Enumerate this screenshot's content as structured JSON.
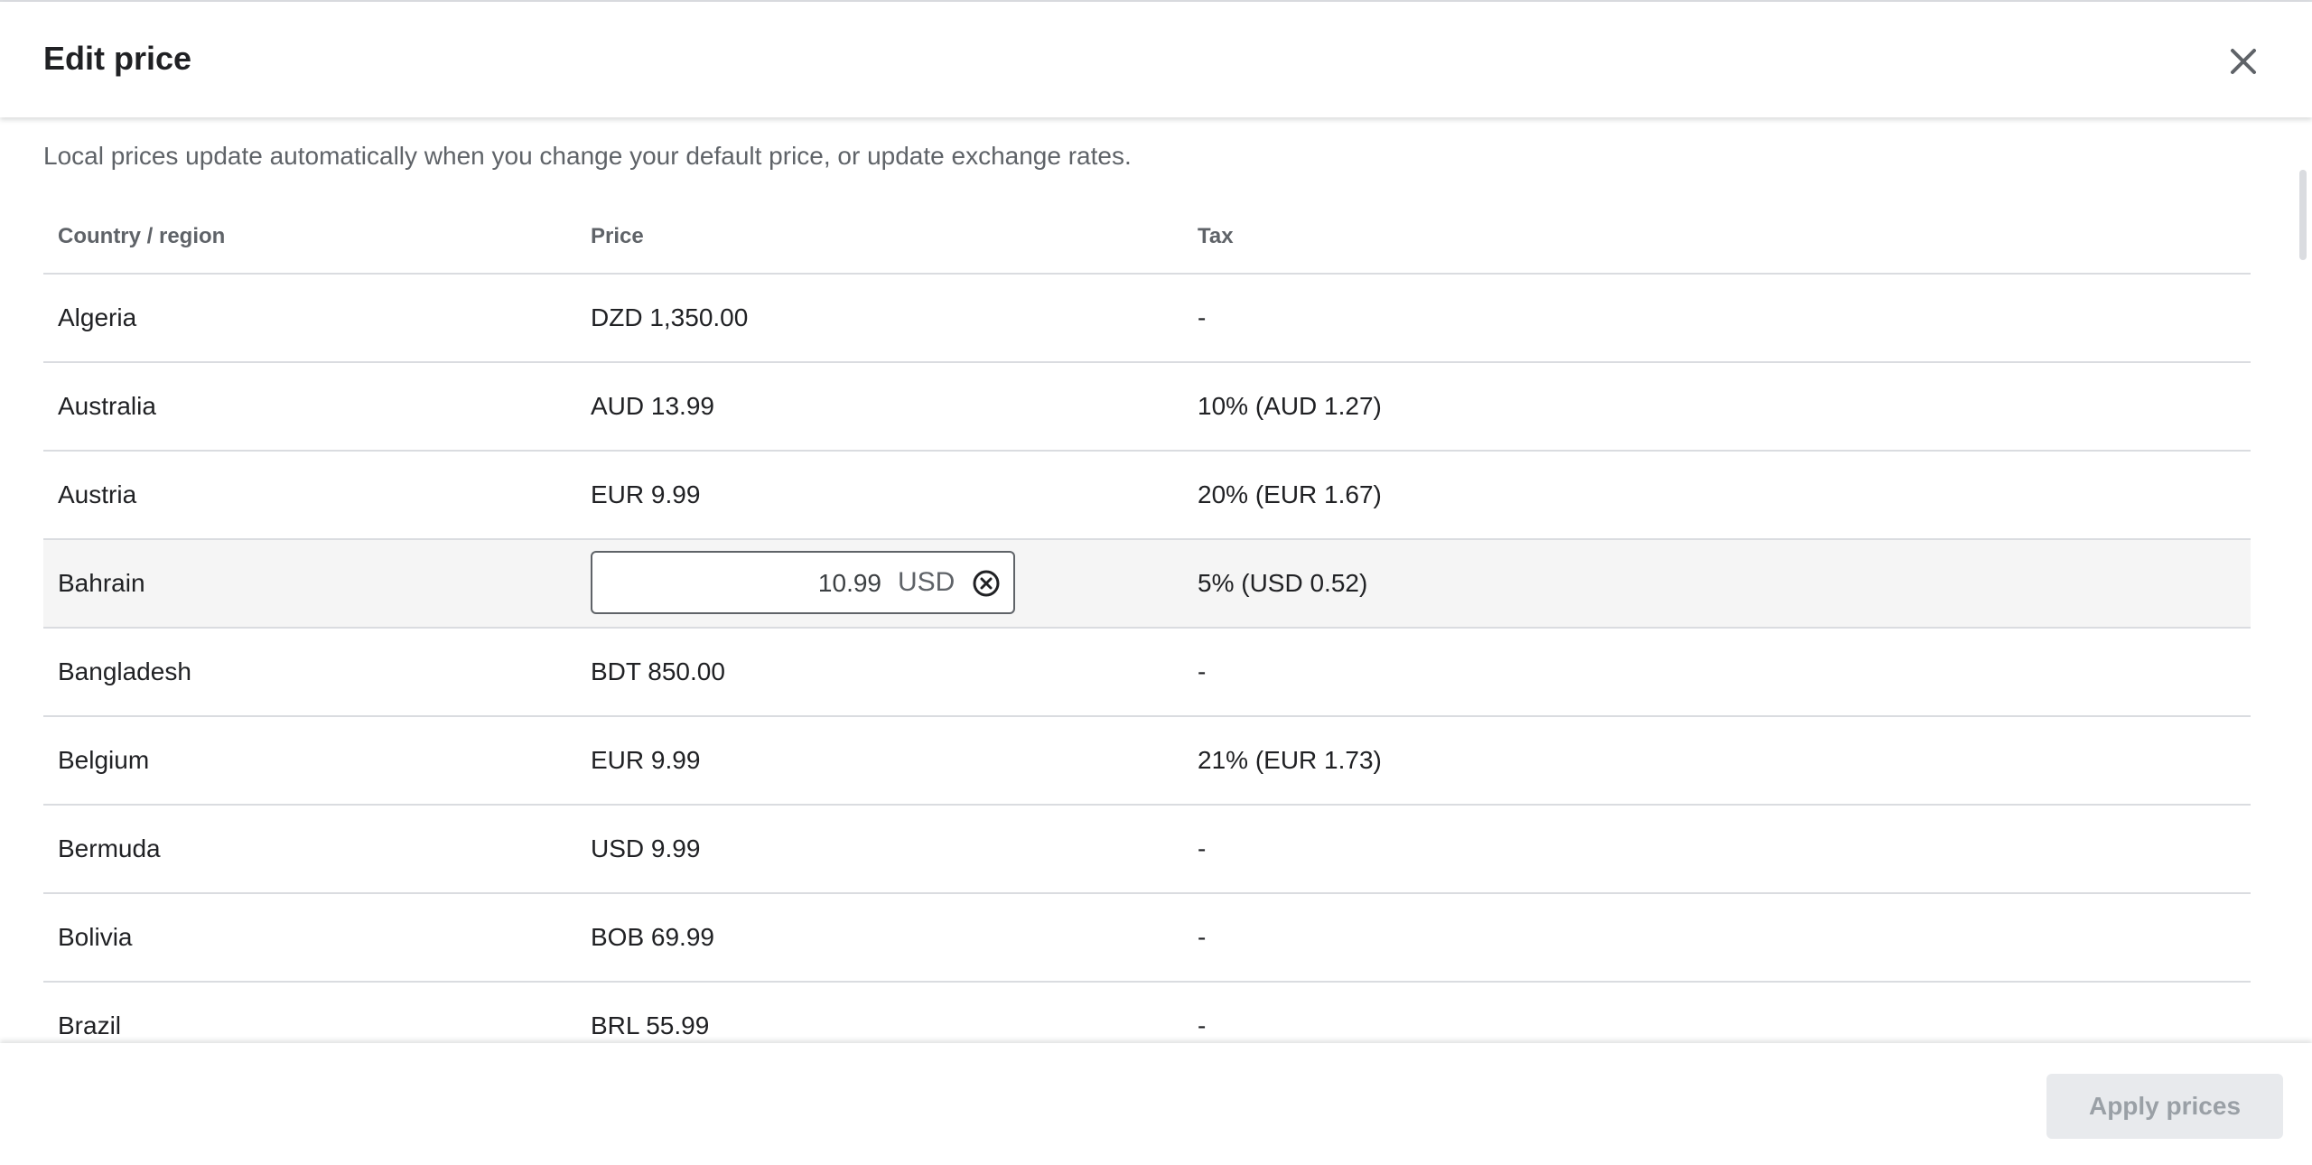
{
  "dialog": {
    "title": "Edit price",
    "description": "Local prices update automatically when you change your default price, or update exchange rates."
  },
  "table": {
    "headers": {
      "country": "Country / region",
      "price": "Price",
      "tax": "Tax"
    },
    "rows": [
      {
        "country": "Algeria",
        "price": "DZD 1,350.00",
        "tax": "-"
      },
      {
        "country": "Australia",
        "price": "AUD 13.99",
        "tax": "10% (AUD 1.27)"
      },
      {
        "country": "Austria",
        "price": "EUR 9.99",
        "tax": "20% (EUR 1.67)"
      },
      {
        "country": "Bahrain",
        "price_input": {
          "value": "10.99",
          "currency": "USD"
        },
        "tax": "5% (USD 0.52)"
      },
      {
        "country": "Bangladesh",
        "price": "BDT 850.00",
        "tax": "-"
      },
      {
        "country": "Belgium",
        "price": "EUR 9.99",
        "tax": "21% (EUR 1.73)"
      },
      {
        "country": "Bermuda",
        "price": "USD 9.99",
        "tax": "-"
      },
      {
        "country": "Bolivia",
        "price": "BOB 69.99",
        "tax": "-"
      },
      {
        "country": "Brazil",
        "price": "BRL 55.99",
        "tax": "-"
      }
    ]
  },
  "footer": {
    "apply_label": "Apply prices"
  },
  "icons": {
    "close": "close-icon",
    "clear": "clear-circle-icon"
  },
  "colors": {
    "selected_row": "#f5f5f5",
    "divider": "#dadce0",
    "disabled_button_bg": "#e8eaed",
    "disabled_button_text": "#9aa0a6"
  }
}
